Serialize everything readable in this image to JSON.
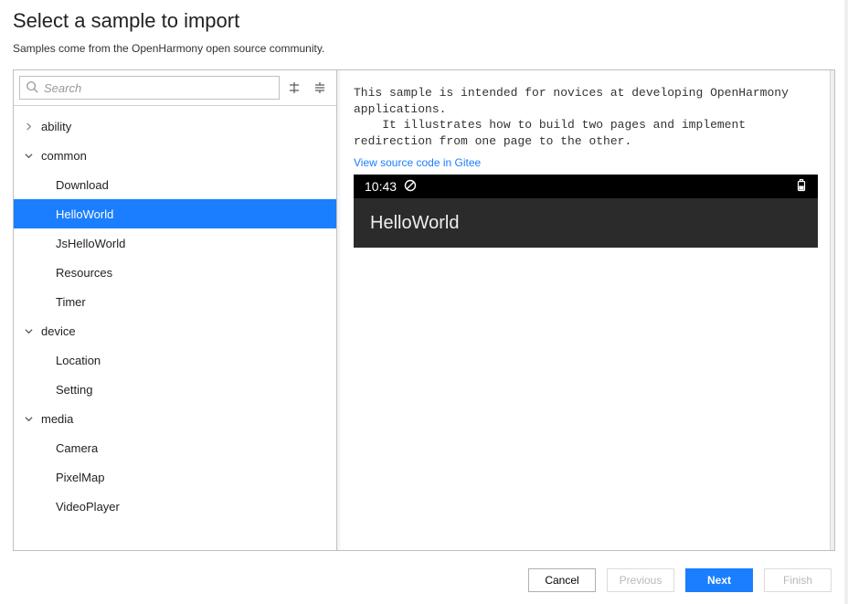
{
  "header": {
    "title": "Select a sample to import",
    "subtitle": "Samples come from the OpenHarmony open source community."
  },
  "search": {
    "placeholder": "Search",
    "value": ""
  },
  "tree": [
    {
      "label": "ability",
      "expanded": false,
      "children": []
    },
    {
      "label": "common",
      "expanded": true,
      "children": [
        {
          "label": "Download",
          "selected": false
        },
        {
          "label": "HelloWorld",
          "selected": true
        },
        {
          "label": "JsHelloWorld",
          "selected": false
        },
        {
          "label": "Resources",
          "selected": false
        },
        {
          "label": "Timer",
          "selected": false
        }
      ]
    },
    {
      "label": "device",
      "expanded": true,
      "children": [
        {
          "label": "Location",
          "selected": false
        },
        {
          "label": "Setting",
          "selected": false
        }
      ]
    },
    {
      "label": "media",
      "expanded": true,
      "children": [
        {
          "label": "Camera",
          "selected": false
        },
        {
          "label": "PixelMap",
          "selected": false
        },
        {
          "label": "VideoPlayer",
          "selected": false
        }
      ]
    }
  ],
  "detail": {
    "description": "This sample is intended for novices at developing OpenHarmony applications.\n    It illustrates how to build two pages and implement redirection from one page to the other.",
    "link_label": "View source code in Gitee",
    "preview": {
      "status_time": "10:43",
      "appbar_title": "HelloWorld"
    }
  },
  "footer": {
    "cancel": "Cancel",
    "previous": "Previous",
    "next": "Next",
    "finish": "Finish"
  }
}
